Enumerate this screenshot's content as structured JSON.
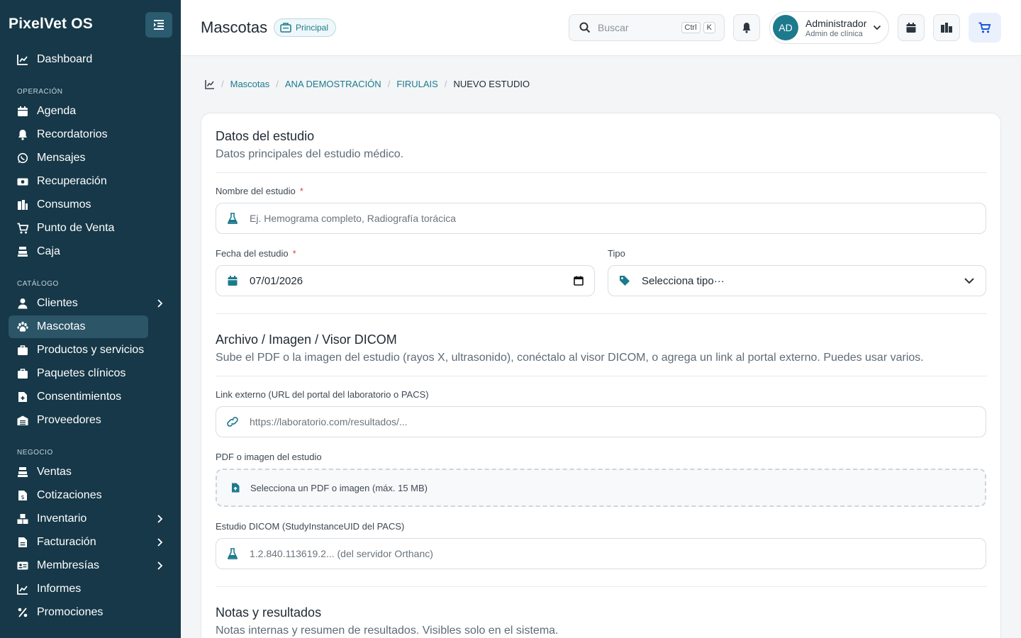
{
  "sidebar": {
    "brand": "PixelVet OS",
    "sections": {
      "operacion": "OPERACIÓN",
      "catalogo": "CATÁLOGO",
      "negocio": "NEGOCIO"
    },
    "items": {
      "dashboard": "Dashboard",
      "agenda": "Agenda",
      "recordatorios": "Recordatorios",
      "mensajes": "Mensajes",
      "recuperacion": "Recuperación",
      "consumos": "Consumos",
      "punto_venta": "Punto de Venta",
      "caja": "Caja",
      "clientes": "Clientes",
      "mascotas": "Mascotas",
      "productos": "Productos y servicios",
      "paquetes": "Paquetes clínicos",
      "consentimientos": "Consentimientos",
      "proveedores": "Proveedores",
      "ventas": "Ventas",
      "cotizaciones": "Cotizaciones",
      "inventario": "Inventario",
      "facturacion": "Facturación",
      "membresias": "Membresías",
      "informes": "Informes",
      "promociones": "Promociones"
    },
    "active": "mascotas"
  },
  "header": {
    "title": "Mascotas",
    "chip": "Principal",
    "search_placeholder": "Buscar",
    "shortcut_ctrl": "Ctrl",
    "shortcut_key": "K",
    "user_name": "Administrador",
    "user_role": "Admin de clínica",
    "avatar_initials": "AD"
  },
  "breadcrumb": {
    "items": [
      "Mascotas",
      "ANA DEMOSTRACIÓN",
      "FIRULAIS"
    ],
    "current": "NUEVO ESTUDIO"
  },
  "form": {
    "datos": {
      "title": "Datos del estudio",
      "desc": "Datos principales del estudio médico.",
      "name_label": "Nombre del estudio",
      "name_placeholder": "Ej. Hemograma completo, Radiografía torácica",
      "date_label": "Fecha del estudio",
      "date_value": "07/01/2026",
      "type_label": "Tipo",
      "type_value": "Selecciona tipo···",
      "required_mark": "*"
    },
    "archivo": {
      "title": "Archivo / Imagen / Visor DICOM",
      "desc": "Sube el PDF o la imagen del estudio (rayos X, ultrasonido), conéctalo al visor DICOM, o agrega un link al portal externo. Puedes usar varios.",
      "link_label": "Link externo (URL del portal del laboratorio o PACS)",
      "link_placeholder": "https://laboratorio.com/resultados/...",
      "file_label": "PDF o imagen del estudio",
      "file_placeholder": "Selecciona un PDF o imagen (máx. 15 MB)",
      "dicom_label": "Estudio DICOM (StudyInstanceUID del PACS)",
      "dicom_placeholder": "1.2.840.113619.2... (del servidor Orthanc)"
    },
    "notas": {
      "title": "Notas y resultados",
      "desc": "Notas internas y resumen de resultados. Visibles solo en el sistema."
    }
  },
  "colors": {
    "sidebar_bg": "#163848",
    "accent": "#1d7a8c",
    "required": "#d64545"
  }
}
